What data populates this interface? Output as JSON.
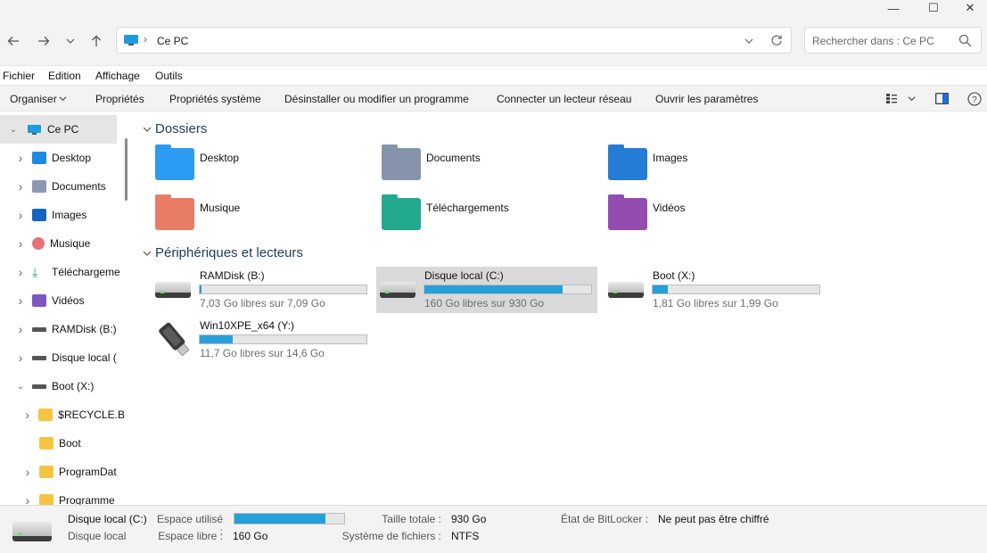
{
  "window": {
    "minimize_glyph": "—",
    "maximize_glyph": "☐",
    "close_glyph": "✕"
  },
  "address": {
    "location": "Ce PC",
    "separator": "›",
    "search_placeholder": "Rechercher dans : Ce PC"
  },
  "menu": [
    "Fichier",
    "Edition",
    "Affichage",
    "Outils"
  ],
  "commands": {
    "organize": "Organiser",
    "properties": "Propriétés",
    "system_properties": "Propriétés système",
    "uninstall": "Désinstaller ou modifier un programme",
    "map_drive": "Connecter un lecteur réseau",
    "open_settings": "Ouvrir les paramètres"
  },
  "nav": {
    "root": "Ce PC",
    "items": [
      {
        "label": "Desktop",
        "icon": "desktop-icon",
        "color": "#1e88e5"
      },
      {
        "label": "Documents",
        "icon": "documents-icon",
        "color": "#8d99ae"
      },
      {
        "label": "Images",
        "icon": "images-icon",
        "color": "#1565c0"
      },
      {
        "label": "Musique",
        "icon": "music-icon",
        "color": "#e57373"
      },
      {
        "label": "Téléchargeme",
        "icon": "download-icon",
        "color": "#1aa37a"
      },
      {
        "label": "Vidéos",
        "icon": "videos-icon",
        "color": "#7e57c2"
      },
      {
        "label": "RAMDisk (B:)",
        "icon": "drive-icon",
        "color": "#555555"
      },
      {
        "label": "Disque local (",
        "icon": "drive-icon",
        "color": "#555555"
      },
      {
        "label": "Boot (X:)",
        "icon": "drive-icon",
        "color": "#555555"
      },
      {
        "label": "$RECYCLE.B",
        "icon": "folder-icon",
        "color": "#f4c542"
      },
      {
        "label": "Boot",
        "icon": "folder-icon",
        "color": "#f4c542"
      },
      {
        "label": "ProgramDat",
        "icon": "folder-icon",
        "color": "#f4c542"
      },
      {
        "label": "Programme",
        "icon": "folder-icon",
        "color": "#f4c542"
      }
    ]
  },
  "sections": {
    "folders_title": "Dossiers",
    "drives_title": "Périphériques et lecteurs"
  },
  "folders": [
    {
      "name": "Desktop",
      "icon": "desktop-folder-icon",
      "color": "#2196f3"
    },
    {
      "name": "Documents",
      "icon": "documents-folder-icon",
      "color": "#7f8fa6"
    },
    {
      "name": "Images",
      "icon": "images-folder-icon",
      "color": "#1976d2"
    },
    {
      "name": "Musique",
      "icon": "music-folder-icon",
      "color": "#e8765f"
    },
    {
      "name": "Téléchargements",
      "icon": "downloads-folder-icon",
      "color": "#17a589"
    },
    {
      "name": "Vidéos",
      "icon": "videos-folder-icon",
      "color": "#8e44ad"
    }
  ],
  "drives": [
    {
      "name": "RAMDisk (B:)",
      "free": "7,03 Go libres sur 7,09 Go",
      "used_fraction": 0.01,
      "icon": "hard-drive-icon"
    },
    {
      "name": "Disque local (C:)",
      "free": "160 Go libres sur 930 Go",
      "used_fraction": 0.83,
      "icon": "hard-drive-icon",
      "selected": true
    },
    {
      "name": "Boot (X:)",
      "free": "1,81 Go libres sur 1,99 Go",
      "used_fraction": 0.09,
      "icon": "hard-drive-icon"
    },
    {
      "name": "Win10XPE_x64 (Y:)",
      "free": "11,7 Go libres sur 14,6 Go",
      "used_fraction": 0.2,
      "icon": "usb-drive-icon"
    }
  ],
  "details": {
    "name": "Disque local (C:)",
    "type": "Disque local",
    "used_label": "Espace utilisé :",
    "free_label": "Espace libre :",
    "free_value": "160 Go",
    "total_label": "Taille totale :",
    "total_value": "930 Go",
    "fs_label": "Système de fichiers :",
    "fs_value": "NTFS",
    "bitlocker_label": "État de BitLocker :",
    "bitlocker_value": "Ne peut pas être chiffré",
    "used_fraction": 0.83
  },
  "colors": {
    "accent": "#26a0da",
    "selected_bg": "#d9d9d9",
    "nav_selected_bg": "#e5e5e5"
  }
}
